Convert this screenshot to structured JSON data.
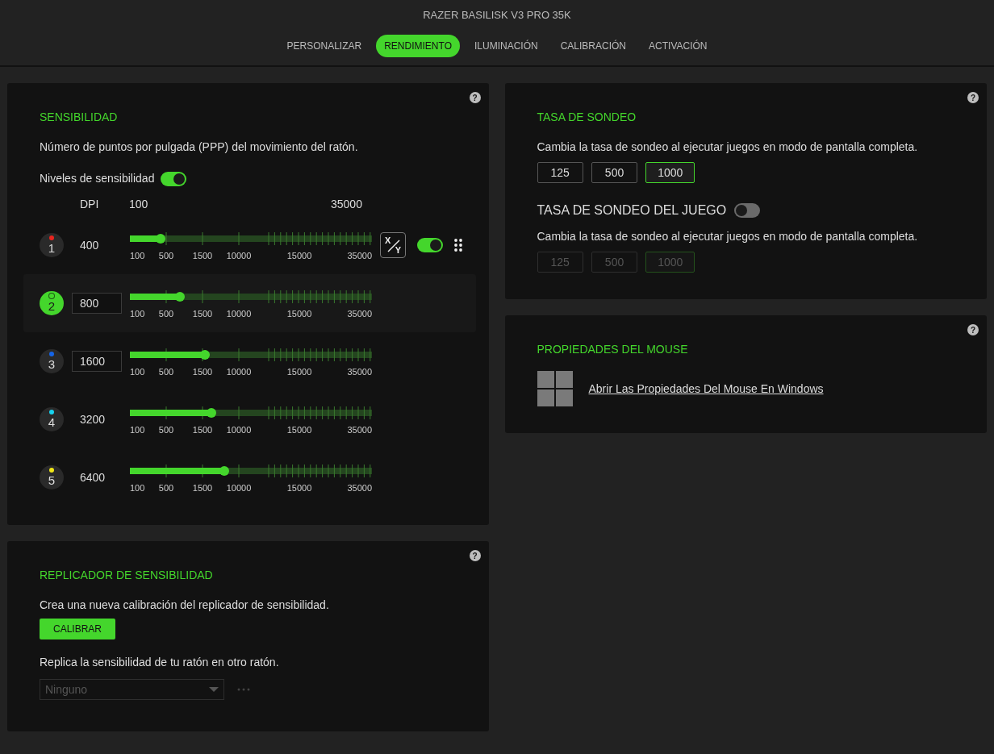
{
  "window": {
    "title": "RAZER BASILISK V3 PRO 35K"
  },
  "tabs": [
    {
      "label": "PERSONALIZAR",
      "selected": false
    },
    {
      "label": "RENDIMIENTO",
      "selected": true
    },
    {
      "label": "ILUMINACIÓN",
      "selected": false
    },
    {
      "label": "CALIBRACIÓN",
      "selected": false
    },
    {
      "label": "ACTIVACIÓN",
      "selected": false
    }
  ],
  "sensitivity": {
    "help": "?",
    "title": "SENSIBILIDAD",
    "description": "Número de puntos por pulgada (PPP) del movimiento del ratón.",
    "levels_label": "Niveles de sensibilidad",
    "levels_on": true,
    "header": {
      "dpi": "DPI",
      "min": "100",
      "max": "35000"
    },
    "rows": [
      {
        "number": "1",
        "value": "400",
        "kind": "text",
        "color": "#e8251f",
        "selected": false,
        "level": 0.127,
        "scale": [
          "100",
          "500",
          "1500",
          "10000",
          "15000",
          "35000"
        ],
        "actions": {
          "x": "X",
          "y": "Y",
          "on": true
        }
      },
      {
        "number": "2",
        "value": "800",
        "kind": "input",
        "color": "#44d62c",
        "selected": true,
        "level": 0.207,
        "scale": [
          "100",
          "500",
          "1500",
          "10000",
          "15000",
          "35000"
        ]
      },
      {
        "number": "3",
        "value": "1600",
        "kind": "input",
        "color": "#1565e8",
        "selected": false,
        "level": 0.31,
        "scale": [
          "100",
          "500",
          "1500",
          "10000",
          "15000",
          "35000"
        ]
      },
      {
        "number": "4",
        "value": "3200",
        "kind": "text",
        "color": "#17d4f0",
        "selected": false,
        "level": 0.337,
        "scale": [
          "100",
          "500",
          "1500",
          "10000",
          "15000",
          "35000"
        ]
      },
      {
        "number": "5",
        "value": "6400",
        "kind": "text",
        "color": "#f0e617",
        "selected": false,
        "level": 0.39,
        "scale": [
          "100",
          "500",
          "1500",
          "10000",
          "15000",
          "35000"
        ]
      }
    ]
  },
  "replicator": {
    "help": "?",
    "title": "REPLICADOR DE SENSIBILIDAD",
    "description": "Crea una nueva calibración del replicador de sensibilidad.",
    "button": "CALIBRAR",
    "description_2": "Replica la sensibilidad de tu ratón en otro ratón.",
    "dropdown": {
      "value": "Ninguno",
      "disabled": true
    }
  },
  "polling": {
    "help": "?",
    "title": "TASA DE SONDEO",
    "description": "Cambia la tasa de sondeo al ejecutar juegos en modo de pantalla completa.",
    "options": [
      {
        "label": "125",
        "selected": false
      },
      {
        "label": "500",
        "selected": false
      },
      {
        "label": "1000",
        "selected": true
      }
    ],
    "game": {
      "title": "TASA DE SONDEO DEL JUEGO",
      "on": false,
      "description": "Cambia la tasa de sondeo al ejecutar juegos en modo de pantalla completa.",
      "disabled": true,
      "options": [
        {
          "label": "125",
          "selected": false
        },
        {
          "label": "500",
          "selected": false
        },
        {
          "label": "1000",
          "selected": true
        }
      ]
    }
  },
  "mouse_properties": {
    "help": "?",
    "title": "PROPIEDADES DEL MOUSE",
    "link": "Abrir Las Propiedades Del Mouse En Windows"
  }
}
